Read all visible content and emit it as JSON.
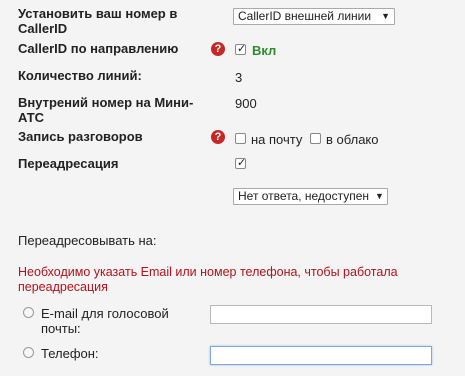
{
  "rows": {
    "own_number": {
      "label": "Установить ваш номер в CallerID",
      "select": "CallerID внешней линии"
    },
    "callerid_direction": {
      "label": "CallerID по направлению",
      "help": "?",
      "checked": true,
      "status": "Вкл"
    },
    "lines_count": {
      "label": "Количество линий:",
      "value": "3"
    },
    "internal_number": {
      "label": "Внутрений номер на Мини-АТС",
      "value": "900"
    },
    "recording": {
      "label": "Запись разговоров",
      "help": "?",
      "option_mail": "на почту",
      "option_cloud": "в облако"
    },
    "forwarding": {
      "label": "Переадресация",
      "checked": true,
      "condition_select": "Нет ответа, недоступен"
    }
  },
  "forward_to": {
    "title": "Переадресовывать на:",
    "error": "Необходимо указать Email или номер телефона, чтобы работала переадресация",
    "email_label": "E-mail для голосовой почты:",
    "phone_label": "Телефон:",
    "email_value": "",
    "phone_value": ""
  }
}
